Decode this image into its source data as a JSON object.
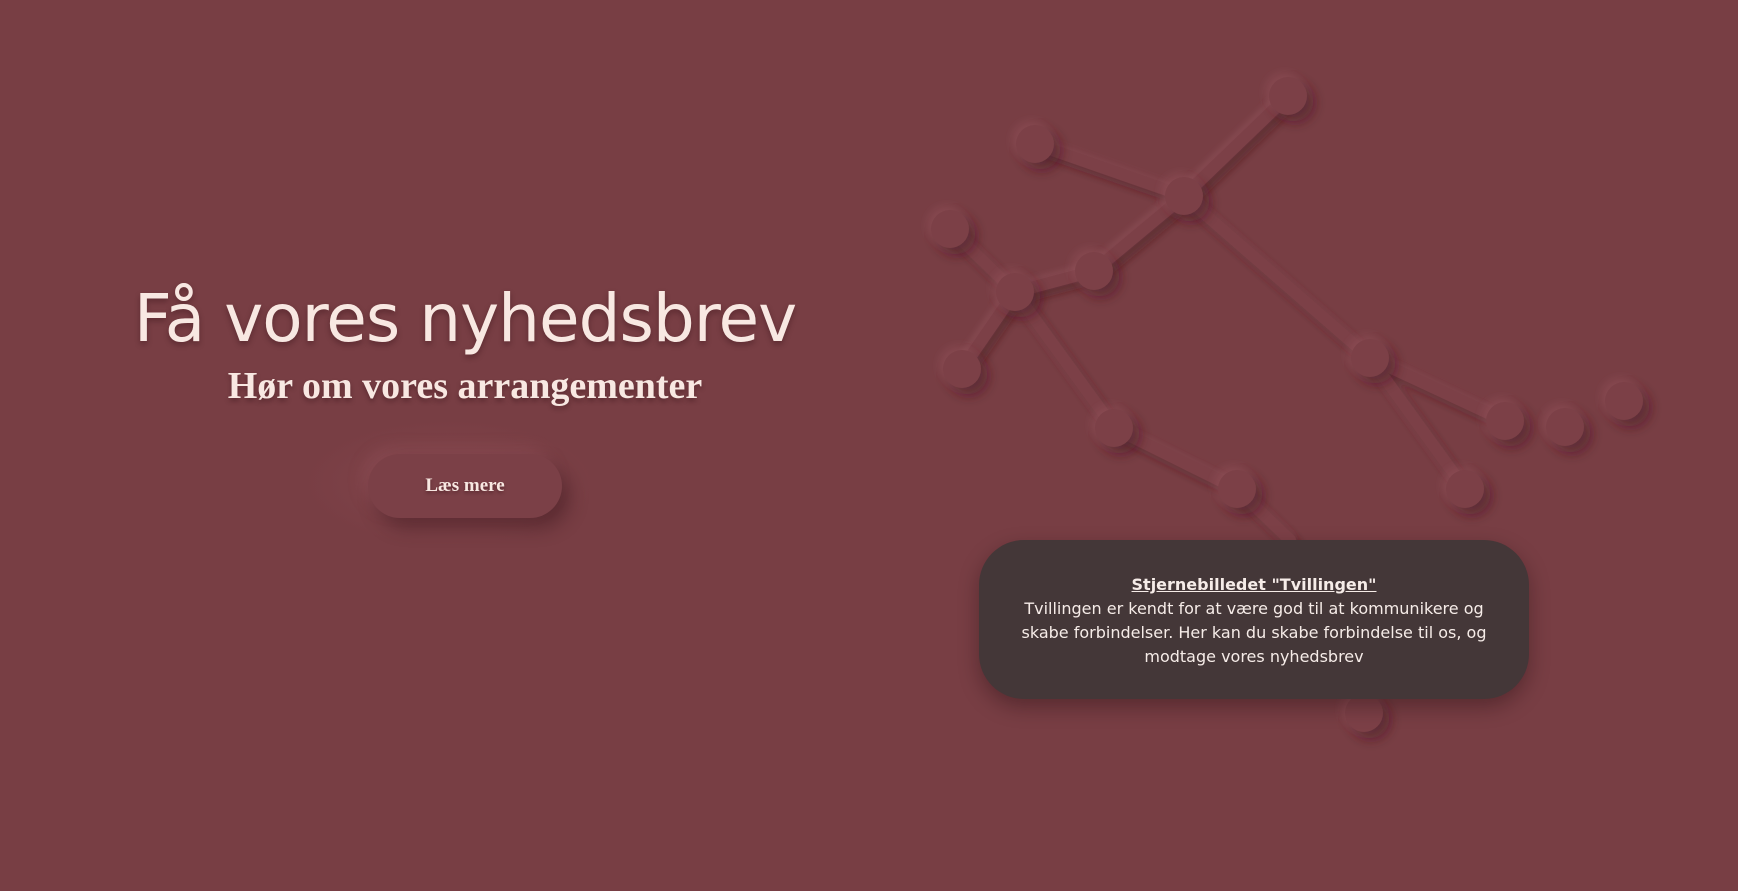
{
  "hero": {
    "title": "Få vores nyhedsbrev",
    "subtitle": "Hør om vores arrangementer",
    "button_label": "Læs mere"
  },
  "info_card": {
    "title": "Stjernebilledet \"Tvillingen\"",
    "text": "Tvillingen er kendt for at være god til at kommunikere og skabe forbindelser. Her kan du skabe forbindelse til os, og modtage vores nyhedsbrev"
  },
  "colors": {
    "background": "#783e44",
    "text_light": "#f8e8e2",
    "card_background": "#443738",
    "star": "#7b4047"
  },
  "icons": {
    "constellation": "gemini-constellation-graphic"
  }
}
